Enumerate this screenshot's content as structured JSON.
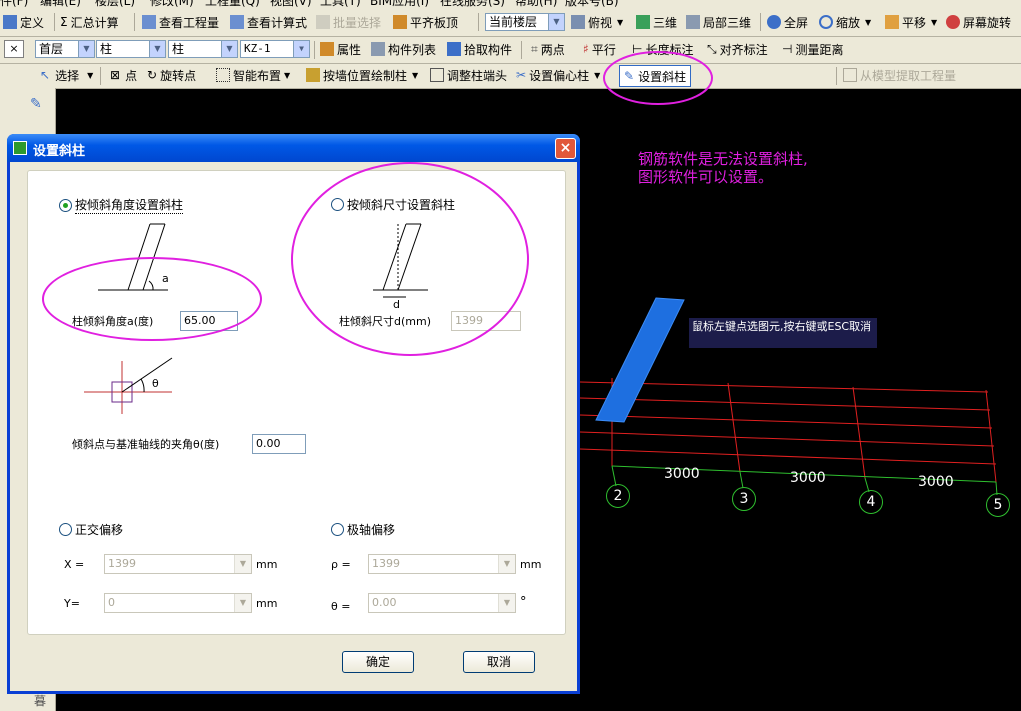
{
  "menubar": {
    "items": [
      "件(F)",
      "编辑(E)",
      "楼层(L)",
      "修改(M)",
      "工程量(Q)",
      "视图(V)",
      "工具(T)",
      "BIM应用(I)",
      "在线服务(S)",
      "帮助(H)",
      "版本号(B)"
    ]
  },
  "toolbar1": {
    "items": [
      "定义",
      "汇总计算",
      "查看工程量",
      "查看计算式",
      "批量选择",
      "平齐板顶",
      "俯视",
      "三维",
      "局部三维",
      "全屏",
      "缩放",
      "平移",
      "屏幕旋转"
    ],
    "floor_select": "当前楼层"
  },
  "toolbar2": {
    "floor": "首层",
    "category": "柱",
    "type": "柱",
    "component": "KZ-1",
    "items": [
      "属性",
      "构件列表",
      "拾取构件",
      "两点",
      "平行",
      "长度标注",
      "对齐标注",
      "测量距离"
    ]
  },
  "toolbar3": {
    "items": [
      "选择",
      "点",
      "旋转点",
      "智能布置",
      "按墙位置绘制柱",
      "调整柱端头",
      "设置偏心柱",
      "设置斜柱",
      "从模型提取工程量"
    ]
  },
  "dialog": {
    "title": "设置斜柱",
    "close_glyph": "×",
    "radio_angle": "按倾斜角度设置斜柱",
    "radio_size": "按倾斜尺寸设置斜柱",
    "angle_label": "柱倾斜角度a(度)",
    "angle_value": "65.00",
    "size_label": "柱倾斜尺寸d(mm)",
    "size_value": "1399",
    "fig_a": "a",
    "fig_d": "d",
    "fig_theta": "θ",
    "theta_label": "倾斜点与基准轴线的夹角θ(度)",
    "theta_value": "0.00",
    "radio_ortho": "正交偏移",
    "radio_polar": "极轴偏移",
    "x_label": "X =",
    "x_value": "1399",
    "y_label": "Y=",
    "y_value": "0",
    "rho_label": "ρ =",
    "rho_value": "1399",
    "polar_theta_label": "θ =",
    "polar_theta_value": "0.00",
    "unit_mm": "mm",
    "unit_deg": "°",
    "ok": "确定",
    "cancel": "取消"
  },
  "annotation": {
    "line1": "钢筋软件是无法设置斜柱,",
    "line2": "图形软件可以设置。"
  },
  "tooltip": "鼠标左键点选图元,按右键或ESC取消",
  "canvas": {
    "dims": [
      "3000",
      "3000",
      "3000"
    ],
    "axes": [
      "2",
      "3",
      "4",
      "5"
    ]
  },
  "left_strip_bottom": "暮",
  "colors": {
    "annotation": "#e020e0",
    "grid": "#e02020",
    "axis": "#2fbf2f",
    "column": "#1e6fe0"
  }
}
